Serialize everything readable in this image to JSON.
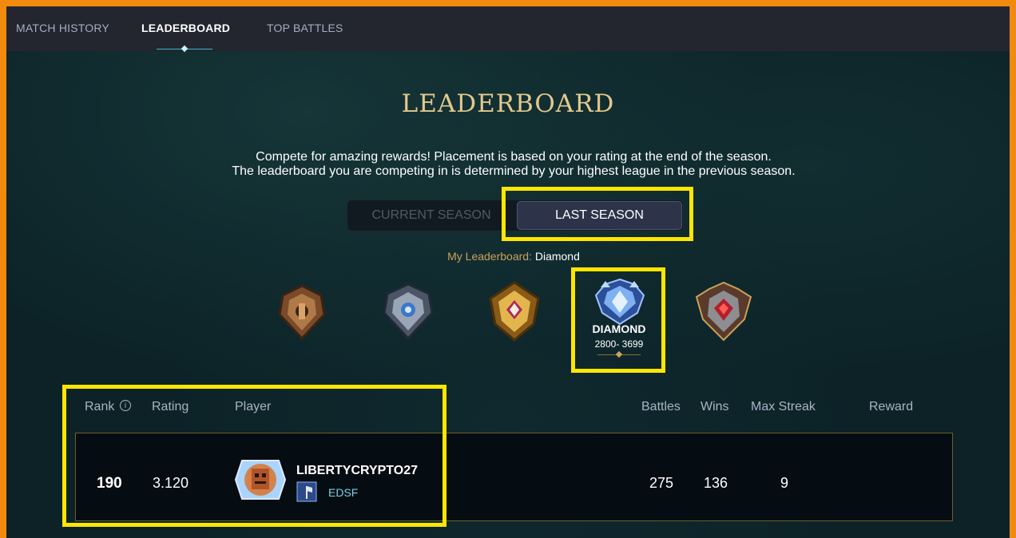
{
  "nav": {
    "tabs": [
      {
        "label": "MATCH HISTORY",
        "active": false
      },
      {
        "label": "LEADERBOARD",
        "active": true
      },
      {
        "label": "TOP BATTLES",
        "active": false
      }
    ]
  },
  "page": {
    "title": "LEADERBOARD",
    "description_line1": "Compete for amazing rewards! Placement is based on your rating at the end of the season.",
    "description_line2": "The leaderboard you are competing in is determined by your highest league in the previous season."
  },
  "season_toggle": {
    "current_label": "CURRENT SEASON",
    "last_label": "LAST SEASON",
    "selected": "last"
  },
  "my_leaderboard": {
    "label": "My Leaderboard:",
    "value": "Diamond"
  },
  "leagues": {
    "icons": [
      "bronze-league-icon",
      "silver-league-icon",
      "gold-league-icon",
      "diamond-league-icon",
      "champion-league-icon"
    ],
    "selected": {
      "name": "DIAMOND",
      "range": "2800- 3699"
    }
  },
  "table": {
    "headers": {
      "rank": "Rank",
      "rating": "Rating",
      "player": "Player",
      "battles": "Battles",
      "wins": "Wins",
      "max_streak": "Max Streak",
      "reward": "Reward"
    },
    "row": {
      "rank": "190",
      "rating": "3.120",
      "player": "LIBERTYCRYPTO27",
      "guild": "EDSF",
      "battles": "275",
      "wins": "136",
      "max_streak": "9",
      "reward": ""
    }
  },
  "colors": {
    "highlight": "#ffe600",
    "frame": "#f28a10",
    "title_gold": "#e2c98d",
    "background": "#0c2227"
  }
}
